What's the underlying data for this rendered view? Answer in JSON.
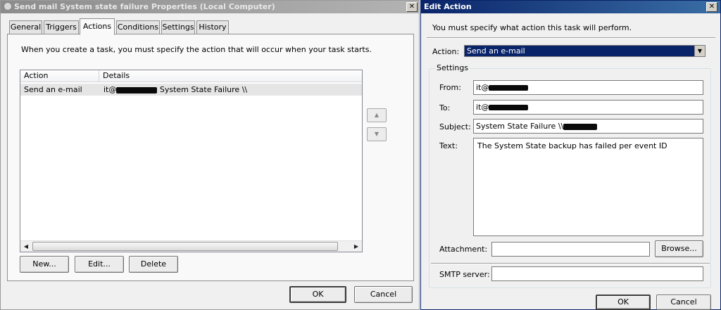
{
  "props_window": {
    "title": "Send mail System state failure Properties (Local Computer)",
    "close_glyph": "✕",
    "tabs": [
      {
        "label": "General"
      },
      {
        "label": "Triggers"
      },
      {
        "label": "Actions"
      },
      {
        "label": "Conditions"
      },
      {
        "label": "Settings"
      },
      {
        "label": "History"
      }
    ],
    "selected_tab": "Actions",
    "intro_text": "When you create a task, you must specify the action that will occur when your task starts.",
    "list": {
      "columns": [
        "Action",
        "Details"
      ],
      "rows": [
        {
          "action": "Send an e-mail",
          "details_prefix": "it@",
          "details_suffix": " System State Failure \\\\"
        }
      ]
    },
    "move_up_glyph": "▲",
    "move_down_glyph": "▼",
    "scroll_left_glyph": "◀",
    "scroll_right_glyph": "▶",
    "buttons": {
      "new": "New...",
      "edit": "Edit...",
      "delete": "Delete",
      "ok": "OK",
      "cancel": "Cancel"
    }
  },
  "edit_window": {
    "title": "Edit Action",
    "close_glyph": "✕",
    "instruction": "You must specify what action this task will perform.",
    "action_label": "Action:",
    "action_value": "Send an e-mail",
    "combo_glyph": "▼",
    "settings_legend": "Settings",
    "from_label": "From:",
    "from_value": "it@",
    "to_label": "To:",
    "to_value": "it@",
    "subject_label": "Subject:",
    "subject_value": "System State Failure \\\\",
    "text_label": "Text:",
    "text_value": "The System State backup has failed per event ID",
    "attachment_label": "Attachment:",
    "attachment_value": "",
    "browse_label": "Browse...",
    "smtp_label": "SMTP server:",
    "smtp_value": "",
    "ok_label": "OK",
    "cancel_label": "Cancel"
  },
  "colors": {
    "active_title": "#0a246a",
    "inactive_title": "#8c8c8c",
    "dialog_face": "#f0f0f0",
    "selection": "#0a246a"
  },
  "icons": {
    "window_icon": "task-scheduler-icon"
  }
}
